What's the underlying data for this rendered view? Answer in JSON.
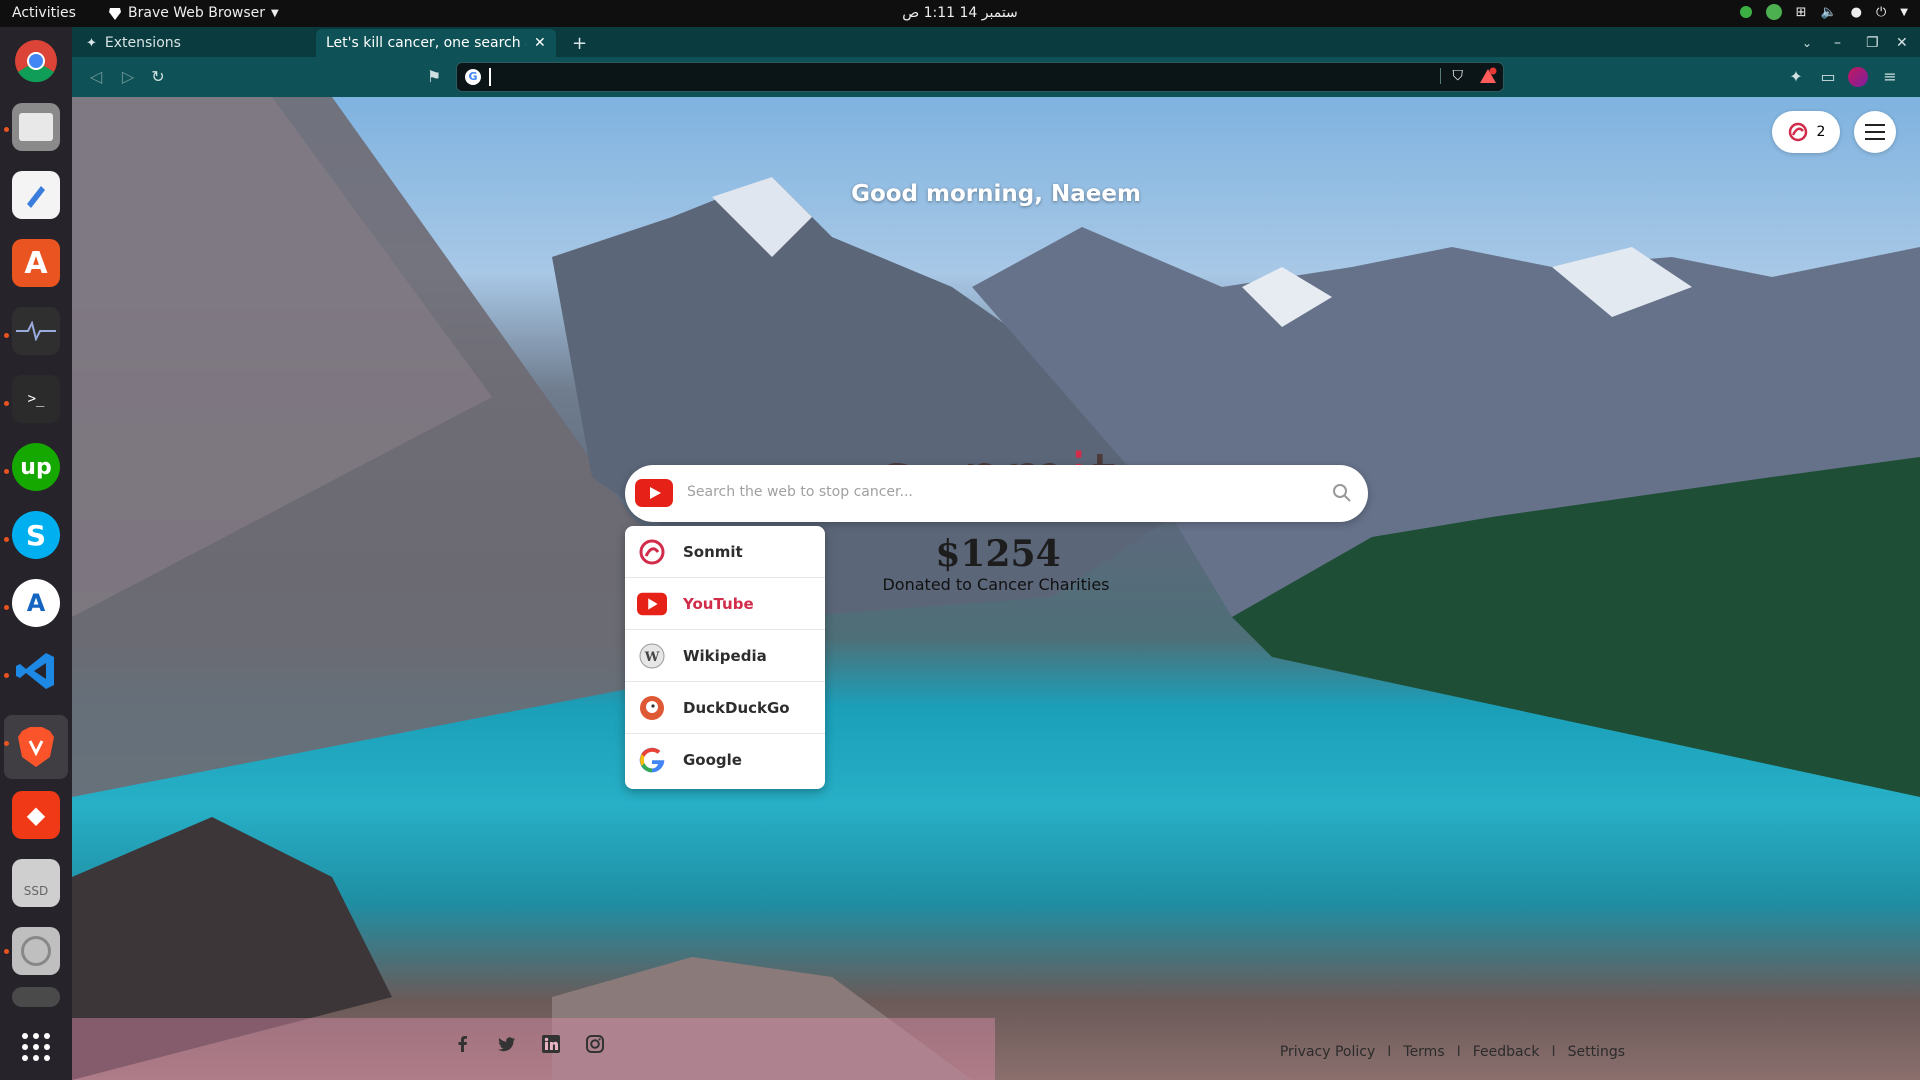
{
  "topbar": {
    "activities": "Activities",
    "app_menu": "Brave Web Browser",
    "clock": "ستمبر 14  1:11 ص"
  },
  "tabs": [
    {
      "label": "Extensions"
    },
    {
      "label": "Let's kill cancer, one search at"
    }
  ],
  "urlbar": {
    "value": ""
  },
  "page": {
    "greeting": "Good morning, Naeem",
    "logo": {
      "pre": "s",
      "mid": "nm",
      "accent": "i",
      "post": "t"
    },
    "search_placeholder": "Search the web to stop cancer...",
    "counter": "2",
    "donation_amount": "$1254",
    "donation_label": "Donated to Cancer Charities",
    "engines": [
      {
        "label": "Sonmit",
        "icon": "sonmit-icon"
      },
      {
        "label": "YouTube",
        "icon": "youtube-icon",
        "selected": true
      },
      {
        "label": "Wikipedia",
        "icon": "wikipedia-icon"
      },
      {
        "label": "DuckDuckGo",
        "icon": "duckduckgo-icon"
      },
      {
        "label": "Google",
        "icon": "google-icon"
      }
    ],
    "footer_links": [
      "Privacy Policy",
      "Terms",
      "Feedback",
      "Settings"
    ],
    "footer_separator": "I"
  },
  "colors": {
    "accent": "#d12c4a",
    "toolbar": "#0e5156",
    "tabstrip": "#0a3b3e"
  }
}
